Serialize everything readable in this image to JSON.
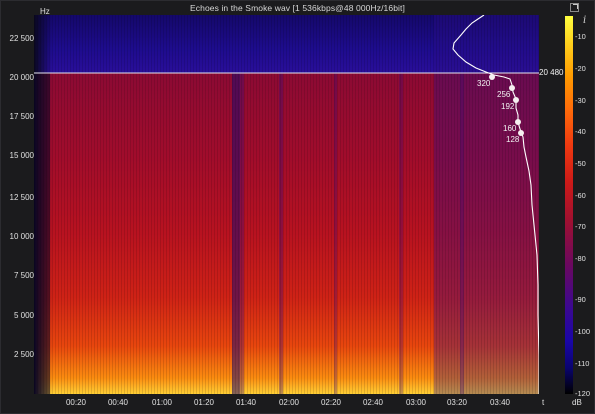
{
  "window": {
    "title": "Echoes in the Smoke wav [1 536kbps@48 000Hz/16bit]"
  },
  "toolbar": {
    "expand_icon": "expand-icon",
    "info_icon_text": "i"
  },
  "colors": {
    "background": "#1b1b1d",
    "spectrum_low": "#1a06a8",
    "spectrum_mid": "#cc1a18",
    "spectrum_high": "#ffd21e",
    "curve": "#ffffff"
  },
  "axes": {
    "y_unit": "Hz",
    "y_ticks": [
      "22 500",
      "20 000",
      "17 500",
      "15 000",
      "12 500",
      "10 000",
      "7 500",
      "5 000",
      "2 500"
    ],
    "x_unit": "t",
    "x_ticks": [
      "00:20",
      "00:40",
      "01:00",
      "01:20",
      "01:40",
      "02:00",
      "02:20",
      "02:40",
      "03:00",
      "03:20",
      "03:40"
    ]
  },
  "colorbar": {
    "unit": "dB",
    "ticks": [
      "-10",
      "-20",
      "-30",
      "-40",
      "-50",
      "-60",
      "-70",
      "-80",
      "-90",
      "-100",
      "-110",
      "-120"
    ]
  },
  "overlay": {
    "cutoff_label": "20 480",
    "bitrate_markers": [
      "320",
      "256",
      "192",
      "160",
      "128"
    ]
  }
}
